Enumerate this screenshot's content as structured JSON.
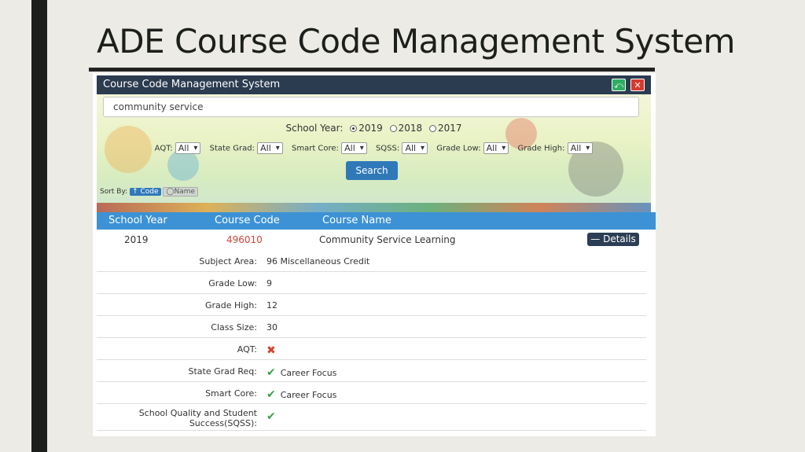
{
  "slide": {
    "title": "ADE Course Code Management System"
  },
  "app": {
    "window_title": "Course Code Management System",
    "search": {
      "value": "community service",
      "placeholder": ""
    },
    "school_year": {
      "label": "School Year:",
      "options": [
        "2019",
        "2018",
        "2017"
      ],
      "selected": "2019"
    },
    "filters": [
      {
        "label": "AQT:",
        "value": "All"
      },
      {
        "label": "State Grad:",
        "value": "All"
      },
      {
        "label": "Smart Core:",
        "value": "All"
      },
      {
        "label": "SQSS:",
        "value": "All"
      },
      {
        "label": "Grade Low:",
        "value": "All"
      },
      {
        "label": "Grade High:",
        "value": "All"
      }
    ],
    "search_button": "Search",
    "sort": {
      "label": "Sort By:",
      "code": "↑ Code",
      "name": "◯Name"
    },
    "table": {
      "headers": [
        "School Year",
        "Course Code",
        "Course Name"
      ],
      "row": {
        "year": "2019",
        "code": "496010",
        "name": "Community Service Learning",
        "details_button": "— Details"
      }
    },
    "details": [
      {
        "label": "Subject Area:",
        "value": "96 Miscellaneous Credit"
      },
      {
        "label": "Grade Low:",
        "value": "9"
      },
      {
        "label": "Grade High:",
        "value": "12"
      },
      {
        "label": "Class Size:",
        "value": "30"
      },
      {
        "label": "AQT:",
        "value": ""
      },
      {
        "label": "State Grad Req:",
        "value": "Career Focus"
      },
      {
        "label": "Smart Core:",
        "value": "Career Focus"
      },
      {
        "label": "School Quality and Student",
        "label2": "Success(SQSS):",
        "value": ""
      }
    ],
    "colors": {
      "header": "#3c92d5",
      "titlebar": "#2b3b50",
      "code_red": "#d1453b",
      "check_green": "#3aa04a"
    }
  }
}
